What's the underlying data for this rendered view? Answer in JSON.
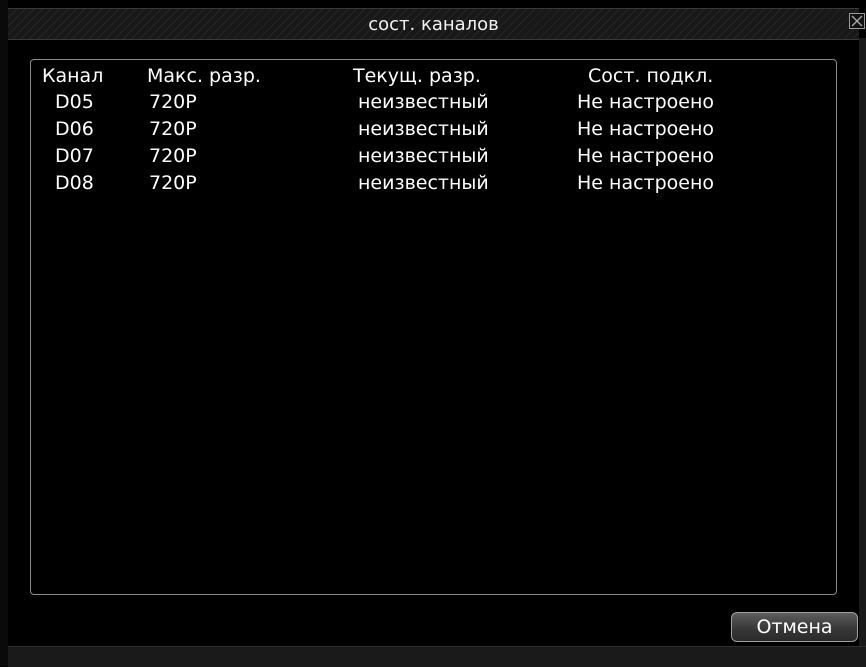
{
  "window": {
    "title": "сост. каналов"
  },
  "table": {
    "headers": [
      "Канал",
      "Макс. разр.",
      "Текущ. разр.",
      "Сост. подкл."
    ],
    "rows": [
      [
        "D05",
        "720P",
        "неизвестный",
        "Не настроено"
      ],
      [
        "D06",
        "720P",
        "неизвестный",
        "Не настроено"
      ],
      [
        "D07",
        "720P",
        "неизвестный",
        "Не настроено"
      ],
      [
        "D08",
        "720P",
        "неизвестный",
        "Не настроено"
      ]
    ]
  },
  "buttons": {
    "cancel_label": "Отмена"
  },
  "icons": {
    "close": "close-icon"
  }
}
